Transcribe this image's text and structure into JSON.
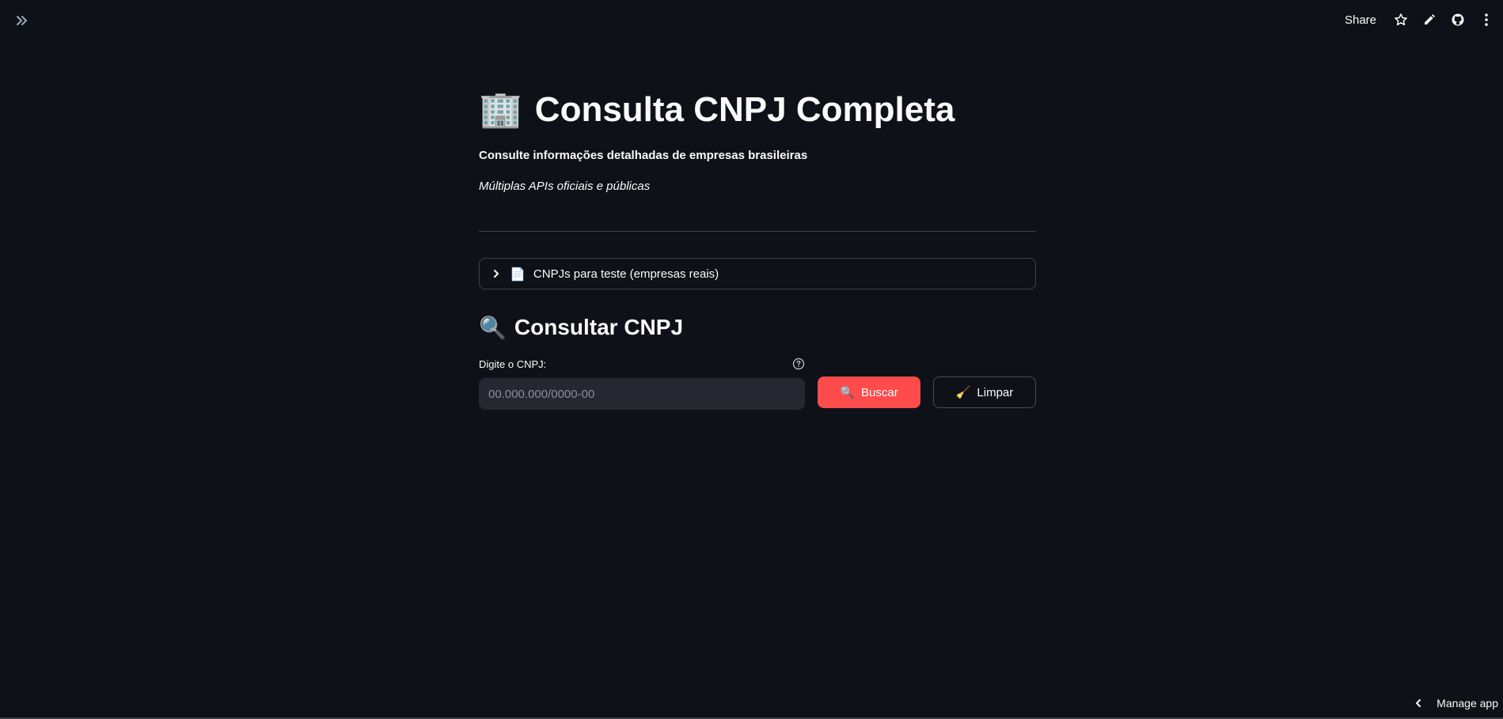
{
  "header": {
    "share_label": "Share"
  },
  "main": {
    "title": "Consulta CNPJ Completa",
    "title_emoji": "🏢",
    "subtitle": "Consulte informações detalhadas de empresas brasileiras",
    "tagline": "Múltiplas APIs oficiais e públicas",
    "expander": {
      "emoji": "📄",
      "label": "CNPJs para teste (empresas reais)"
    },
    "section": {
      "emoji": "🔍",
      "title": "Consultar CNPJ"
    },
    "form": {
      "cnpj_label": "Digite o CNPJ:",
      "cnpj_placeholder": "00.000.000/0000-00",
      "cnpj_value": "",
      "search_emoji": "🔍",
      "search_label": "Buscar",
      "clear_emoji": "🧹",
      "clear_label": "Limpar"
    }
  },
  "footer": {
    "manage_label": "Manage app"
  },
  "colors": {
    "background": "#0e1117",
    "primary": "#ff4b4b",
    "input_bg": "#262730",
    "border": "#3d4048"
  },
  "icons": {
    "sidebar_toggle": "double-chevron-right-icon",
    "star": "star-icon",
    "edit": "pencil-icon",
    "github": "github-icon",
    "menu": "kebab-menu-icon",
    "expander": "chevron-right-icon",
    "help": "question-circle-icon",
    "manage": "chevron-left-icon"
  }
}
